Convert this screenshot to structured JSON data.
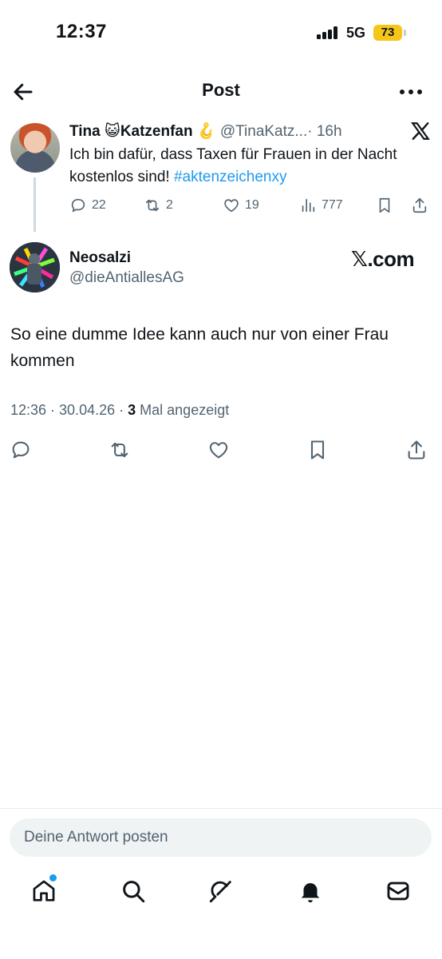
{
  "status_bar": {
    "time": "12:37",
    "network": "5G",
    "battery": "73"
  },
  "nav": {
    "title": "Post",
    "back_icon": "arrow-left-icon",
    "more_icon": "more-horizontal-icon"
  },
  "parent_tweet": {
    "name_part1": "Tina",
    "name_emoji1": "😺",
    "name_part2": "Katzenfan",
    "name_emoji2": "🪝",
    "handle": "@TinaKatz...",
    "time": "· 16h",
    "text": "Ich bin dafür, dass Taxen für Frauen in der Nacht kostenlos sind!",
    "hashtag": "#aktenzeichenxy",
    "stats": {
      "replies": "22",
      "reposts": "2",
      "likes": "19",
      "views": "777"
    }
  },
  "main_tweet": {
    "name": "Neosalzi",
    "handle": "@dieAntiallesAG",
    "brand": "𝕏.com",
    "text": "So eine dumme Idee kann auch nur von einer Frau kommen",
    "meta_prefix": "12:36 · 30.04.26 ·",
    "views_count": "3",
    "views_label": "Mal angezeigt"
  },
  "reply": {
    "placeholder": "Deine Antwort posten"
  },
  "tabs": [
    "home-icon",
    "search-icon",
    "grok-icon",
    "notifications-icon",
    "messages-icon"
  ],
  "colors": {
    "accent": "#1d9bf0",
    "text": "#0f1419",
    "secondary": "#536471",
    "battery": "#f5c518"
  }
}
